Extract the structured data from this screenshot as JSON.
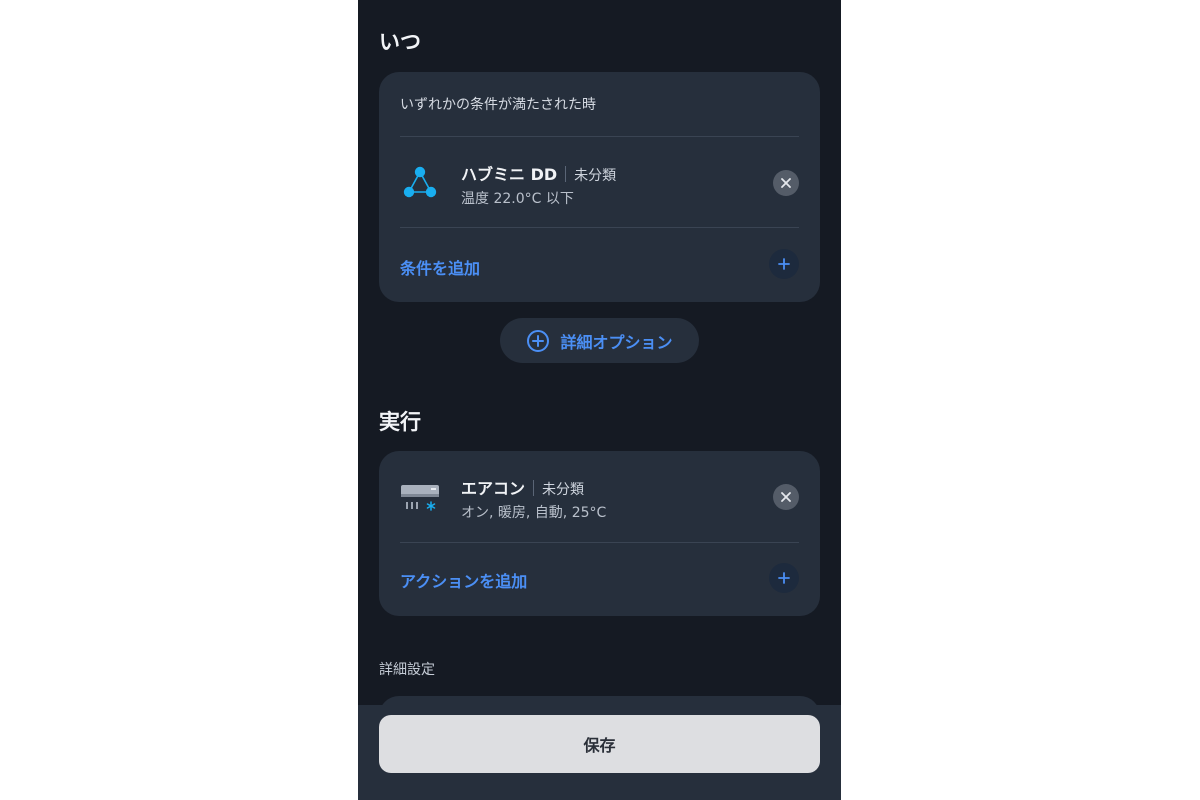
{
  "when": {
    "title": "いつ",
    "condition_header": "いずれかの条件が満たされた時",
    "device": {
      "name": "ハブミニ DD",
      "room": "未分類",
      "detail": "温度 22.0°C 以下",
      "icon": "hub-network-icon"
    },
    "add_label": "条件を追加"
  },
  "advanced_option": {
    "label": "詳細オプション"
  },
  "execute": {
    "title": "実行",
    "device": {
      "name": "エアコン",
      "room": "未分類",
      "detail": "オン, 暖房, 自動, 25°C",
      "icon": "air-conditioner-icon"
    },
    "add_label": "アクションを追加"
  },
  "advanced_settings": {
    "label": "詳細設定"
  },
  "save": {
    "label": "保存"
  },
  "colors": {
    "background": "#151a23",
    "card": "#262f3c",
    "accent": "#4b8ff5",
    "icon_cyan": "#19aef0",
    "save_button": "#dddee1"
  }
}
